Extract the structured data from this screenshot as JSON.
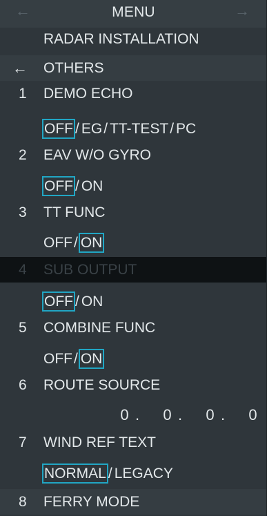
{
  "header": {
    "left_arrow": "←",
    "right_arrow": "→",
    "title": "MENU",
    "submenu": "RADAR INSTALLATION"
  },
  "back_row": {
    "icon": "←",
    "label": "OTHERS"
  },
  "items": [
    {
      "num": "1",
      "label": "DEMO ECHO",
      "options": [
        "OFF",
        "EG",
        "TT-TEST",
        "PC"
      ],
      "selected": "OFF"
    },
    {
      "num": "2",
      "label": "EAV W/O GYRO",
      "options": [
        "OFF",
        "ON"
      ],
      "selected": "OFF"
    },
    {
      "num": "3",
      "label": "TT FUNC",
      "options": [
        "OFF",
        "ON"
      ],
      "selected": "ON"
    },
    {
      "num": "4",
      "label": "SUB OUTPUT",
      "options": [
        "OFF",
        "ON"
      ],
      "selected": "OFF",
      "disabled": true
    },
    {
      "num": "5",
      "label": "COMBINE FUNC",
      "options": [
        "OFF",
        "ON"
      ],
      "selected": "ON"
    },
    {
      "num": "6",
      "label": "ROUTE SOURCE",
      "value_digits": [
        "0",
        "0",
        "0",
        "0"
      ],
      "dot": "."
    },
    {
      "num": "7",
      "label": "WIND REF TEXT",
      "options": [
        "NORMAL",
        "LEGACY"
      ],
      "selected": "NORMAL"
    },
    {
      "num": "8",
      "label": "FERRY MODE"
    }
  ],
  "separator": "/",
  "colors": {
    "background": "#2f363b",
    "text": "#e3e8ea",
    "selection_outline": "#21a6c4",
    "disabled_row": "#0e1214"
  }
}
